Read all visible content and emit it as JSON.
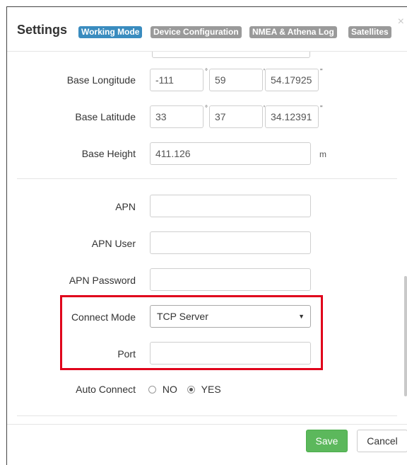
{
  "header": {
    "title": "Settings",
    "tabs": [
      "Working Mode",
      "Device Configuration",
      "NMEA & Athena Log",
      "Satellites"
    ],
    "close_glyph": "×"
  },
  "base_longitude": {
    "label": "Base Longitude",
    "deg": "-111",
    "min": "59",
    "sec": "54.17925"
  },
  "base_latitude": {
    "label": "Base Latitude",
    "deg": "33",
    "min": "37",
    "sec": "34.12391"
  },
  "base_height": {
    "label": "Base Height",
    "value": "411.126",
    "unit": "m"
  },
  "symbols": {
    "degree": "°",
    "minute": "'",
    "second": "\""
  },
  "apn": {
    "label": "APN",
    "value": ""
  },
  "apn_user": {
    "label": "APN User",
    "value": ""
  },
  "apn_password": {
    "label": "APN Password",
    "value": ""
  },
  "connect_mode": {
    "label": "Connect Mode",
    "selected": "TCP Server",
    "caret": "▼"
  },
  "port": {
    "label": "Port",
    "value": ""
  },
  "auto_connect": {
    "label": "Auto Connect",
    "options": [
      "NO",
      "YES"
    ],
    "selected": "YES"
  },
  "footer": {
    "save_label": "Save",
    "cancel_label": "Cancel"
  },
  "colors": {
    "active_tab": "#3a8cbf",
    "inactive_tab": "#9a9a9a",
    "save": "#5cb85c",
    "highlight": "#e0001b"
  }
}
